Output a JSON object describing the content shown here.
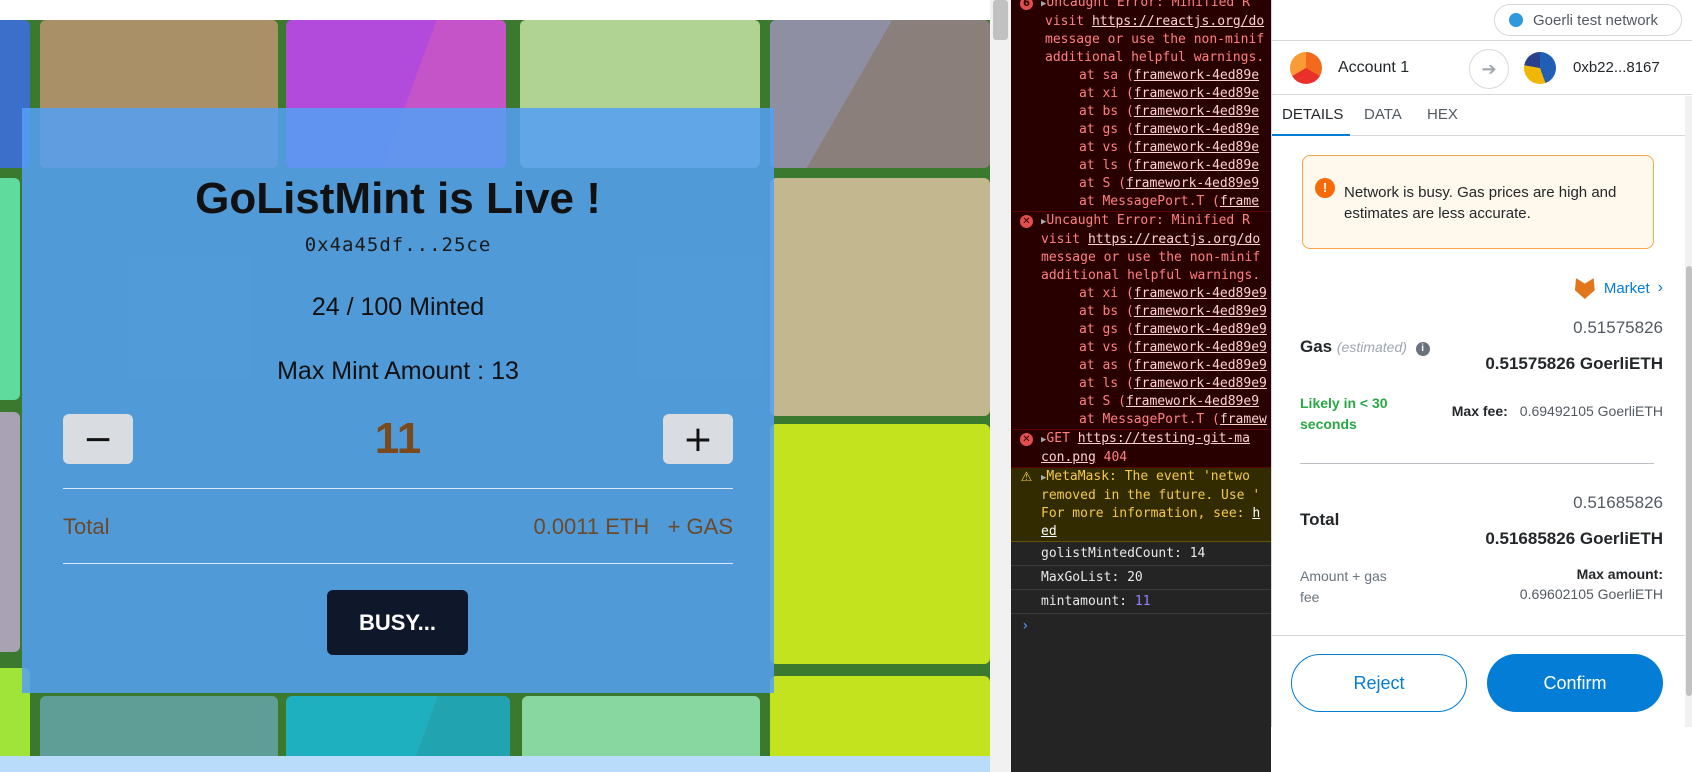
{
  "website": {
    "title": "GoListMint is Live !",
    "contract_address": "0x4a45df...25ce",
    "minted_progress": "24 / 100 Minted",
    "max_mint": "Max Mint Amount : 13",
    "minus_label": "−",
    "plus_label": "+",
    "quantity": "11",
    "total_label": "Total",
    "total_value": "0.0011 ETH   + GAS",
    "busy_label": "BUSY..."
  },
  "console": {
    "error1": {
      "head": "Uncaught Error: Minified R",
      "line1": "visit ",
      "link1": "https://reactjs.org/do",
      "line2": "message or use the non-minif",
      "line3": "additional helpful warnings.",
      "stack": [
        {
          "fn": "at sa (",
          "file": "framework-4ed89e"
        },
        {
          "fn": "at xi (",
          "file": "framework-4ed89e"
        },
        {
          "fn": "at bs (",
          "file": "framework-4ed89e"
        },
        {
          "fn": "at gs (",
          "file": "framework-4ed89e"
        },
        {
          "fn": "at vs (",
          "file": "framework-4ed89e"
        },
        {
          "fn": "at ls (",
          "file": "framework-4ed89e"
        },
        {
          "fn": "at S (",
          "file": "framework-4ed89e9"
        },
        {
          "fn": "at MessagePort.T (",
          "file": "frame"
        }
      ]
    },
    "error2": {
      "head": "Uncaught Error: Minified R",
      "line1": "visit ",
      "link1": "https://reactjs.org/do",
      "line2": "message or use the non-minif",
      "line3": "additional helpful warnings.",
      "stack": [
        {
          "fn": "at xi (",
          "file": "framework-4ed89e9"
        },
        {
          "fn": "at bs (",
          "file": "framework-4ed89e9"
        },
        {
          "fn": "at gs (",
          "file": "framework-4ed89e9"
        },
        {
          "fn": "at vs (",
          "file": "framework-4ed89e9"
        },
        {
          "fn": "at as (",
          "file": "framework-4ed89e9"
        },
        {
          "fn": "at ls (",
          "file": "framework-4ed89e9"
        },
        {
          "fn": "at S (",
          "file": "framework-4ed89e9"
        },
        {
          "fn": "at MessagePort.T (",
          "file": "framew"
        }
      ]
    },
    "error3": {
      "head": "GET ",
      "link": "https://testing-git-ma",
      "link2": "con.png",
      "code": "404"
    },
    "warning": {
      "line1": "MetaMask: The event 'netwo",
      "line2": "removed in the future. Use '",
      "line3": "For more information, see: ",
      "link_tail": "h",
      "line4": "ed"
    },
    "logs": [
      {
        "key": "golistMintedCount: ",
        "value": "14",
        "plain": true
      },
      {
        "key": "MaxGoList: ",
        "value": "20",
        "plain": true
      },
      {
        "key": "mintamount: ",
        "value": "11",
        "plain": false
      }
    ],
    "prompt": "›"
  },
  "metamask": {
    "network": "Goerli test network",
    "from_account": "Account 1",
    "to_account": "0xb22...8167",
    "tabs": [
      "DETAILS",
      "DATA",
      "HEX"
    ],
    "warning": "Network is busy. Gas prices are high and estimates are less accurate.",
    "market_label": "Market",
    "gas_label": "Gas",
    "gas_estimated": "(estimated)",
    "gas_fiat": "0.51575826",
    "gas_value": "0.51575826 GoerliETH",
    "likely": "Likely in < 30 seconds",
    "max_fee_label": "Max fee:",
    "max_fee_value": "0.69492105 GoerliETH",
    "total_label": "Total",
    "total_fiat": "0.51685826",
    "total_value": "0.51685826 GoerliETH",
    "amount_gas": "Amount + gas fee",
    "max_amount_label": "Max amount:",
    "max_amount_value": "0.69602105 GoerliETH",
    "reject": "Reject",
    "confirm": "Confirm",
    "colors": {
      "accent": "#037dd6",
      "success": "#28a745",
      "warning_border": "#f8a745"
    }
  }
}
